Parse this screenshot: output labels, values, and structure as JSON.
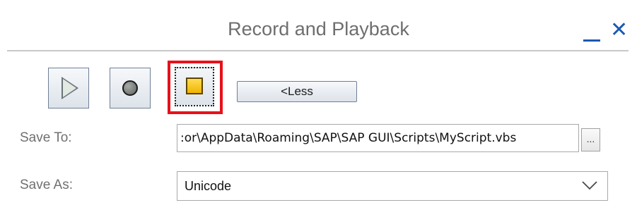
{
  "window": {
    "title": "Record and Playback",
    "minimize_label": "minimize",
    "close_glyph": "✕"
  },
  "toolbar": {
    "play_icon": "play-icon",
    "record_icon": "record-icon",
    "stop_icon": "stop-icon",
    "less_label": "<Less",
    "highlight_color": "#e8101a"
  },
  "form": {
    "save_to_label": "Save To:",
    "save_to_value": ":or\\AppData\\Roaming\\SAP\\SAP GUI\\Scripts\\MyScript.vbs",
    "browse_label": "...",
    "save_as_label": "Save As:",
    "save_as_value": "Unicode"
  },
  "colors": {
    "accent": "#1a5ab0",
    "stop_fill": "#f0b400"
  }
}
